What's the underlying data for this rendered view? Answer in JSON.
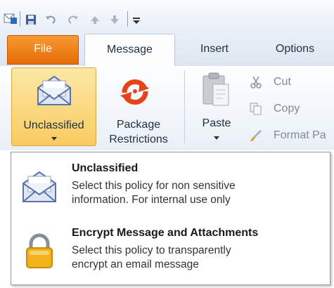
{
  "quick_access": {
    "icons": [
      "outlook-envelope-icon",
      "save-icon",
      "undo-icon",
      "redo-icon",
      "up-arrow-icon",
      "down-arrow-icon",
      "customize-icon"
    ]
  },
  "tabs": [
    {
      "label": "File",
      "active": false
    },
    {
      "label": "Message",
      "active": true
    },
    {
      "label": "Insert",
      "active": false
    },
    {
      "label": "Options",
      "active": false
    }
  ],
  "ribbon": {
    "unclassified_label": "Unclassified",
    "package_label_1": "Package",
    "package_label_2": "Restrictions",
    "paste_label": "Paste",
    "cut_label": "Cut",
    "copy_label": "Copy",
    "format_painter_label": "Format Pa"
  },
  "dropdown": {
    "items": [
      {
        "title": "Unclassified",
        "line1": "Select this policy for non sensitive",
        "line2": "information.  For internal use only",
        "icon": "envelope-icon"
      },
      {
        "title": "Encrypt Message and Attachments",
        "line1": "Select this policy to transparently",
        "line2": "encrypt an email message",
        "icon": "padlock-icon"
      }
    ]
  },
  "colors": {
    "file_tab": "#e56c05",
    "highlight": "#f9cc61",
    "accent": "#1f2f44"
  }
}
